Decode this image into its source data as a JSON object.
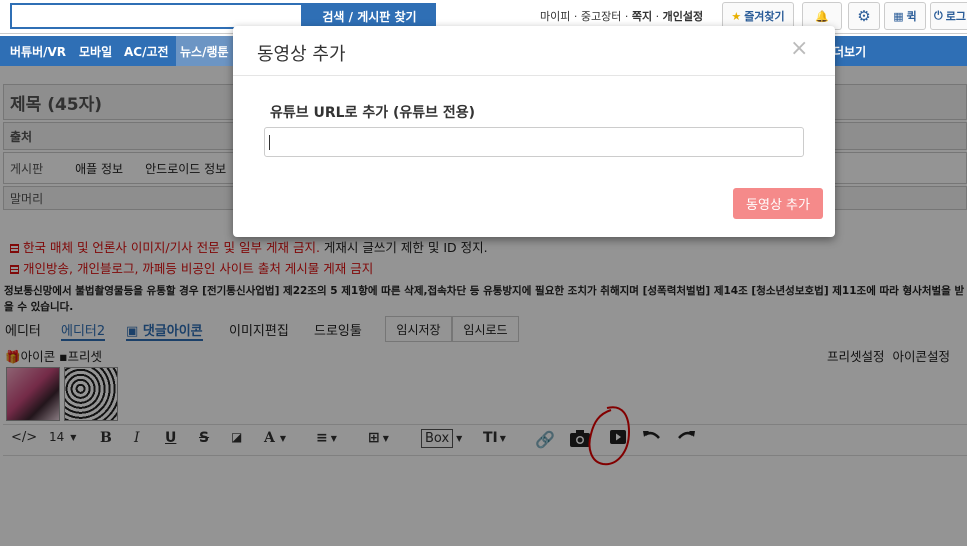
{
  "topbar": {
    "search_placeholder": "",
    "search_button": "검색 / 게시판 찾기",
    "links": [
      "마이피",
      "중고장터",
      "쪽지",
      "개인설정"
    ],
    "favorites": "즐겨찾기",
    "quick": "퀵",
    "login": "로그"
  },
  "nav": {
    "items": [
      "버튜버/VR",
      "모바일",
      "AC/고전",
      "뉴스/랭툰",
      "더보기"
    ]
  },
  "form": {
    "title_placeholder": "제목 (45자)",
    "source_label": "출처",
    "board_label": "게시판",
    "board_options": [
      "애플 정보",
      "안드로이드 정보"
    ],
    "prefix_label": "말머리"
  },
  "notices": {
    "line1_red": "한국 매체 및 언론사 이미지/기사 전문 및 일부 게재 금지.",
    "line1_black": " 게재시 글쓰기 제한 및 ID 정지.",
    "line2_red": "개인방송, 개인블로그, 까페등 비공인 사이트 출처 게시물 게재 금지",
    "legal": "정보통신망에서 불법촬영물등을 유통할 경우 [전기통신사업법] 제22조의 5 제1항에 따른 삭제,접속차단 등 유통방지에 필요한 조치가 취해지며 [성폭력처벌법] 제14조 [청소년성보호법] 제11조에 따라 형사처벌을 받을 수 있습니다."
  },
  "editor_tabs": {
    "editor": "에디터",
    "editor2": "에디터2",
    "comment_icon": "댓글아이콘",
    "image_edit": "이미지편집",
    "drawing": "드로잉툴",
    "temp_save": "임시저장",
    "temp_load": "임시로드"
  },
  "icon_bar": {
    "icon": "아이콘",
    "preset": "프리셋",
    "preset_settings": "프리셋설정",
    "icon_settings": "아이콘설정"
  },
  "toolbar": {
    "code": "</>",
    "font_size": "14",
    "bold": "B",
    "italic": "I",
    "underline": "U",
    "strike": "S",
    "text_color": "A",
    "box": "Box",
    "typeface": "TI"
  },
  "modal": {
    "title": "동영상 추가",
    "close": "×",
    "url_label": "유튜브 URL로 추가 (유튜브 전용)",
    "url_value": "",
    "add_button": "동영상 추가"
  },
  "colors": {
    "brand_blue": "#2f6fb5",
    "notice_red": "#dd1111",
    "add_button": "#f58a8a",
    "annotation": "#e00000"
  }
}
